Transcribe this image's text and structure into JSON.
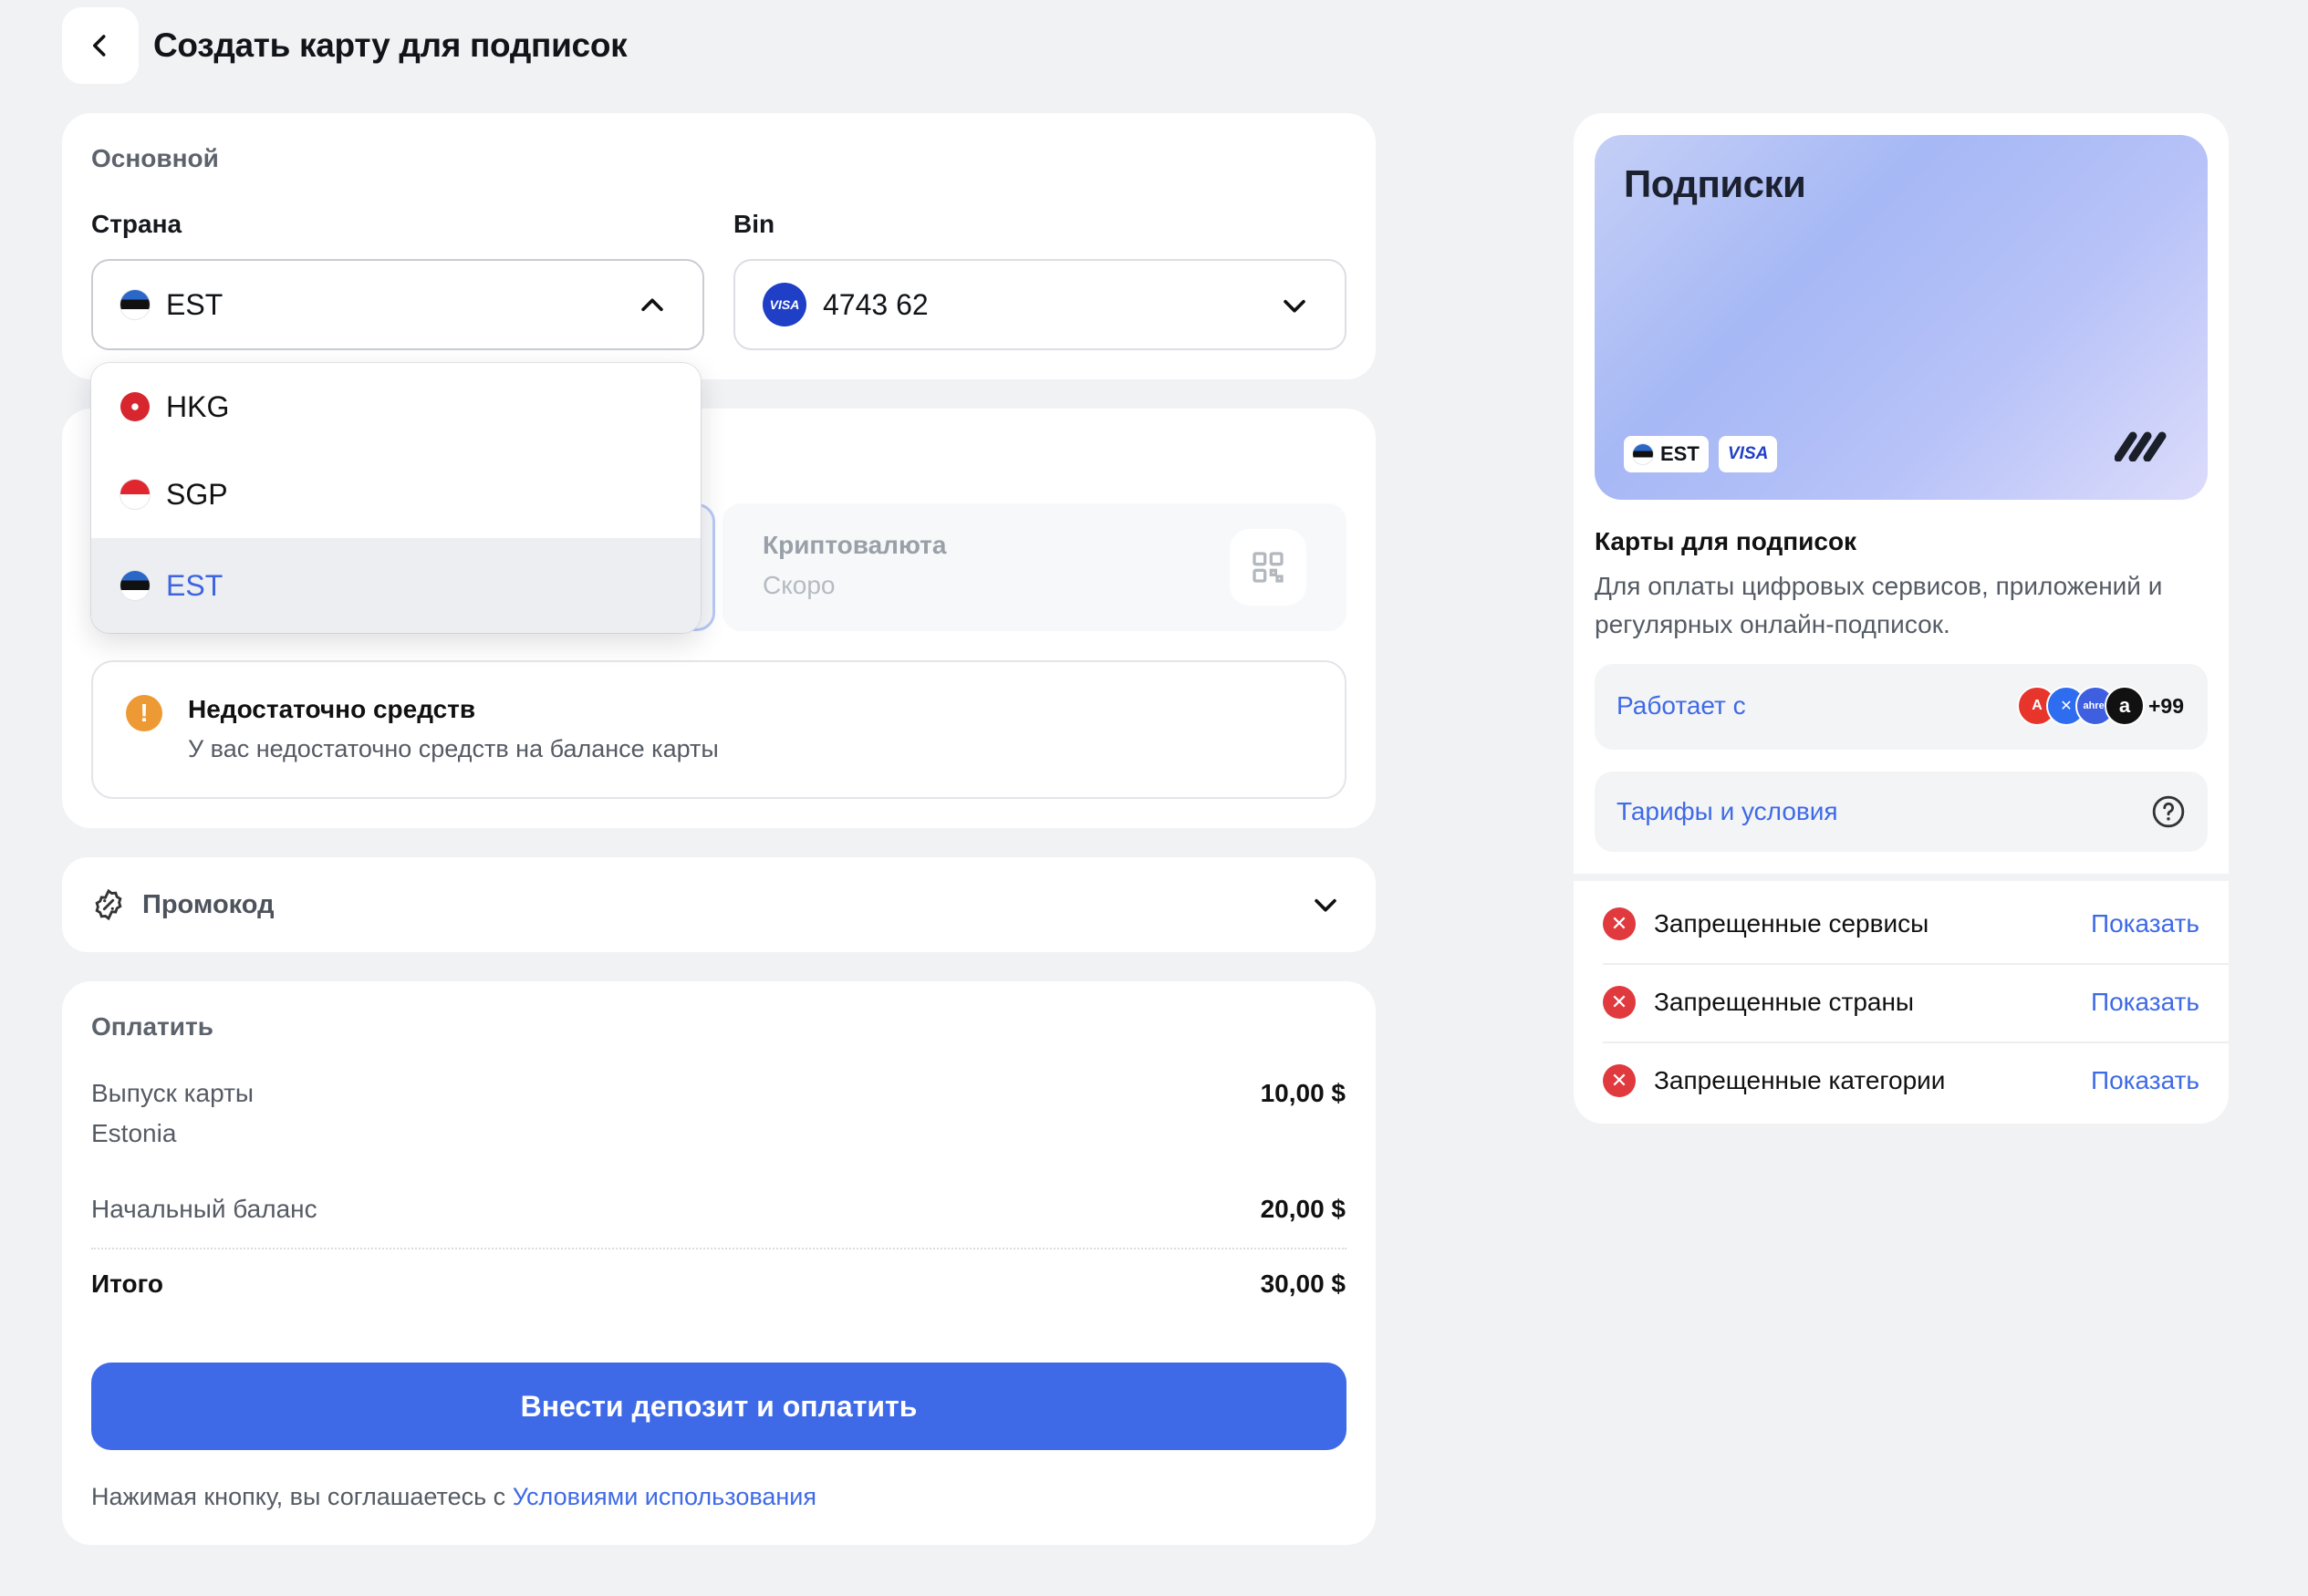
{
  "header": {
    "title": "Создать карту для подписок"
  },
  "main_section": {
    "label": "Основной",
    "country": {
      "label": "Страна",
      "value": "EST"
    },
    "bin": {
      "label": "Bin",
      "value": "4743 62",
      "brand": "VISA"
    },
    "dropdown": {
      "options": [
        {
          "code": "HKG",
          "flag": "hong-kong"
        },
        {
          "code": "SGP",
          "flag": "singapore"
        },
        {
          "code": "EST",
          "flag": "estonia",
          "selected": true
        }
      ]
    }
  },
  "payment_method": {
    "crypto": {
      "title": "Криптовалюта",
      "subtitle": "Скоро"
    }
  },
  "alert": {
    "title": "Недостаточно средств",
    "text": "У вас недостаточно средств на балансе карты"
  },
  "promo": {
    "label": "Промокод"
  },
  "pay": {
    "label": "Оплатить",
    "rows": [
      {
        "label": "Выпуск карты",
        "sublabel": "Estonia",
        "value": "10,00 $"
      },
      {
        "label": "Начальный баланс",
        "value": "20,00 $"
      },
      {
        "label": "Итого",
        "value": "30,00 $"
      }
    ],
    "button": "Внести депозит и оплатить",
    "terms_prefix": "Нажимая кнопку, вы соглашаетесь с ",
    "terms_link": "Условиями использования"
  },
  "card_preview": {
    "title": "Подписки",
    "country_tag": "EST",
    "brand_tag": "VISA",
    "heading": "Карты для подписок",
    "description": "Для оплаты цифровых сервисов, приложений и регулярных онлайн-подписок.",
    "works_with": {
      "label": "Работает с",
      "more": "+99",
      "services": [
        "adobe",
        "x",
        "ahrefs",
        "amazon"
      ]
    },
    "tariffs": "Тарифы и условия",
    "restrictions": [
      {
        "label": "Запрещенные сервисы",
        "action": "Показать"
      },
      {
        "label": "Запрещенные страны",
        "action": "Показать"
      },
      {
        "label": "Запрещенные категории",
        "action": "Показать"
      }
    ]
  },
  "colors": {
    "accent": "#3e6ae8",
    "warning": "#ed9a35",
    "danger": "#e03a3e",
    "link": "#3f6ae6"
  }
}
